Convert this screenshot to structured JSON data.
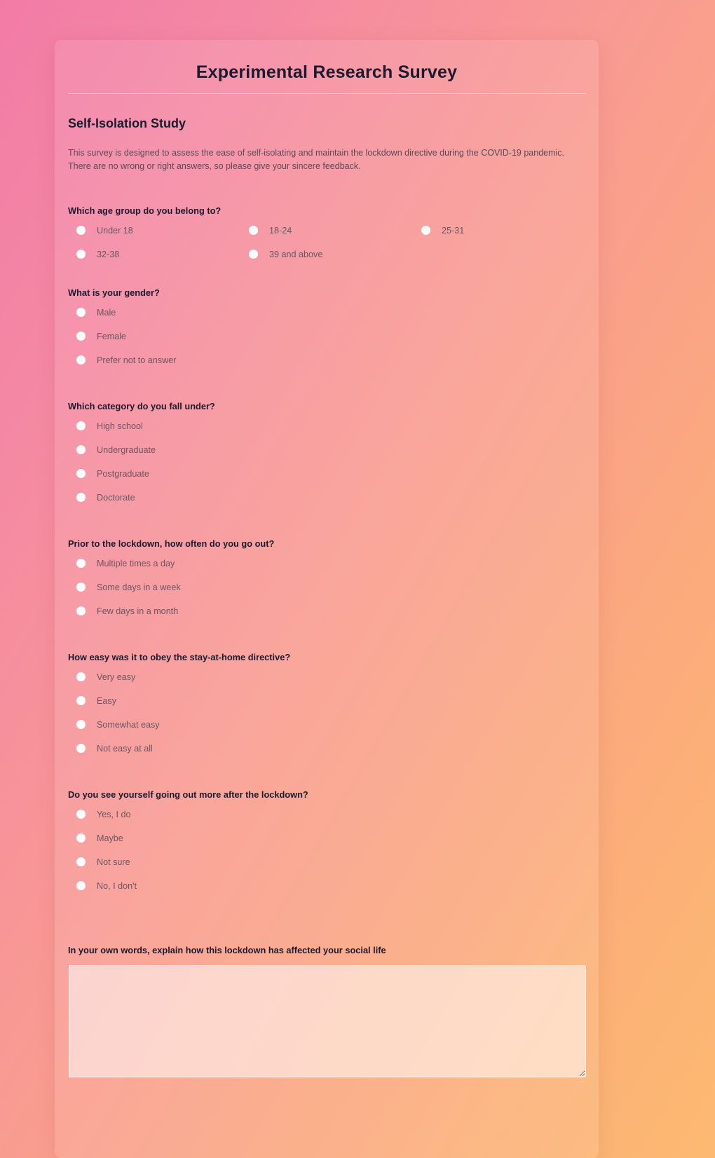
{
  "header": {
    "title": "Experimental Research Survey",
    "subtitle": "Self-Isolation Study",
    "intro": "This survey is designed to assess the ease of self-isolating and maintain the lockdown directive during the COVID-19 pandemic. There are no wrong or right answers, so please give your sincere feedback."
  },
  "colors": {
    "heading": "#1b1b30",
    "option_text": "#6b5562",
    "radio_fill": "#ffffff",
    "gradient_start": "#f27ba6",
    "gradient_end": "#fdb972"
  },
  "questions": [
    {
      "id": "age-group",
      "label": "Which age group do you belong to?",
      "layout": "grid3",
      "options": [
        "Under 18",
        "18-24",
        "25-31",
        "32-38",
        "39 and above"
      ]
    },
    {
      "id": "gender",
      "label": "What is your gender?",
      "layout": "stack",
      "options": [
        "Male",
        "Female",
        "Prefer not to answer"
      ]
    },
    {
      "id": "education-category",
      "label": "Which category do you fall under?",
      "layout": "stack",
      "options": [
        "High school",
        "Undergraduate",
        "Postgraduate",
        "Doctorate"
      ]
    },
    {
      "id": "going-out-frequency",
      "label": "Prior to the lockdown, how often do you go out?",
      "layout": "stack",
      "options": [
        "Multiple times a day",
        "Some days in a week",
        "Few days in a month"
      ]
    },
    {
      "id": "directive-ease",
      "label": "How easy was it to obey the stay-at-home directive?",
      "layout": "stack",
      "options": [
        "Very easy",
        "Easy",
        "Somewhat easy",
        "Not easy at all"
      ]
    },
    {
      "id": "future-going-out",
      "label": "Do you see yourself going out more after the lockdown?",
      "layout": "stack",
      "options": [
        "Yes, I do",
        "Maybe",
        "Not sure",
        "No, I don't"
      ]
    }
  ],
  "free_response": {
    "id": "social-life-impact",
    "label": "In your own words, explain how this lockdown has affected your social life",
    "value": "",
    "placeholder": ""
  }
}
